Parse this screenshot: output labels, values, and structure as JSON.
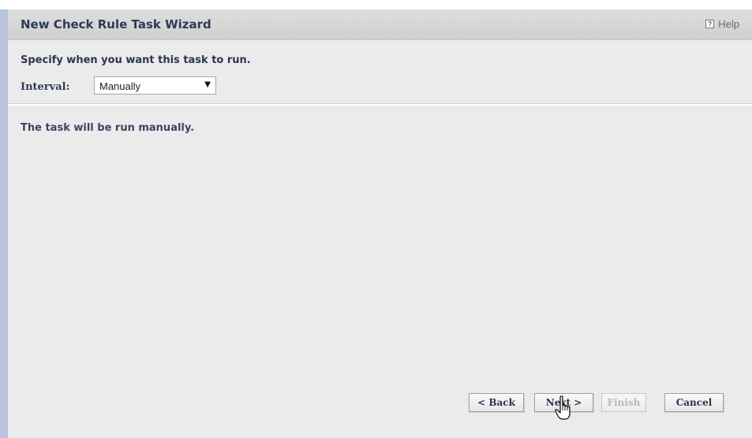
{
  "wizard": {
    "title": "New Check Rule Task Wizard",
    "help_label": "Help",
    "instruction": "Specify when you want this task to run.",
    "interval": {
      "label": "Interval:",
      "selected": "Manually"
    },
    "description": "The task will be run manually.",
    "buttons": {
      "back": "< Back",
      "next": "Next >",
      "finish": "Finish",
      "cancel": "Cancel"
    }
  },
  "colors": {
    "title_text": "#2f3a58",
    "panel_background": "#ebebeb",
    "titlebar_background": "#d6d6d6",
    "left_accent": "#b8c4dc",
    "disabled_text": "#b8b8b8"
  },
  "icons": {
    "help": "help-icon",
    "dropdown": "chevron-down-icon",
    "pointer": "hand-pointer-icon"
  }
}
